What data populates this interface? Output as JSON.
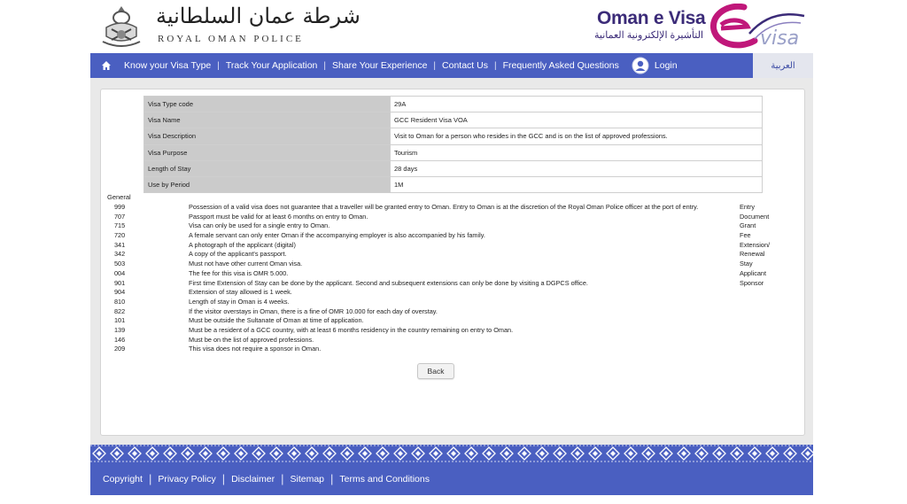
{
  "header": {
    "police_name_ar": "شرطة عمان السلطانية",
    "police_name_en": "ROYAL OMAN POLICE",
    "evisa_title": "Oman e Visa",
    "evisa_subtitle_ar": "التأشيرة الإلكترونية العمانية"
  },
  "nav": {
    "items": [
      "Know your Visa Type",
      "Track Your Application",
      "Share Your Experience",
      "Contact Us",
      "Frequently Asked Questions"
    ],
    "separator": "|",
    "login": "Login",
    "arabic": "العربية"
  },
  "visa_info": [
    {
      "label": "Visa Type code",
      "value": "29A"
    },
    {
      "label": "Visa Name",
      "value": "GCC Resident Visa VOA"
    },
    {
      "label": "Visa Description",
      "value": "Visit to Oman for a person who resides in the GCC and is on the list of approved professions."
    },
    {
      "label": "Visa Purpose",
      "value": "Tourism"
    },
    {
      "label": "Length of Stay",
      "value": "28 days"
    },
    {
      "label": "Use by Period",
      "value": "1M"
    }
  ],
  "general": {
    "label": "General",
    "rules": [
      {
        "code": "999",
        "text": "Possession of a valid visa does not guarantee that a traveller will be granted entry to Oman. Entry to Oman is at the discretion of the Royal Oman Police officer at the port of entry."
      },
      {
        "code": "707",
        "text": "Passport must be valid for at least 6 months on entry to Oman."
      },
      {
        "code": "715",
        "text": "Visa can only be used for a single entry to Oman."
      },
      {
        "code": "720",
        "text": "A female servant can only enter Oman if the accompanying employer is also accompanied by his family."
      },
      {
        "code": "341",
        "text": "A photograph of the applicant (digital)"
      },
      {
        "code": "342",
        "text": "A copy of the applicant's passport."
      },
      {
        "code": "503",
        "text": "Must not have other current Oman visa."
      },
      {
        "code": "004",
        "text": "The fee for this visa is OMR 5.000."
      },
      {
        "code": "901",
        "text": "First time Extension of Stay can be done by the applicant. Second and subsequent extensions can only be done by visiting a DGPCS office."
      },
      {
        "code": "904",
        "text": "Extension of stay allowed is 1 week."
      },
      {
        "code": "810",
        "text": "Length of stay in Oman is 4 weeks."
      },
      {
        "code": "822",
        "text": "If the visitor overstays in Oman, there is a fine of OMR 10.000 for each day of overstay."
      },
      {
        "code": "101",
        "text": "Must be outside the Sultanate of Oman at time of application."
      },
      {
        "code": "139",
        "text": "Must be a resident of a GCC country, with at least 6 months residency in the country remaining on entry to Oman."
      },
      {
        "code": "146",
        "text": "Must be on the list of approved professions."
      },
      {
        "code": "209",
        "text": "This visa does not require a sponsor in Oman."
      }
    ],
    "side_labels": [
      "Entry",
      "Document",
      "Grant",
      "Fee",
      "Extension/",
      "Renewal",
      "Stay",
      "Applicant",
      "Sponsor"
    ]
  },
  "back_button": "Back",
  "footer": {
    "links": [
      "Copyright",
      "Privacy Policy",
      "Disclaimer",
      "Sitemap",
      "Terms and Conditions"
    ],
    "separator": "|"
  },
  "colors": {
    "nav_blue": "#4a5fc1",
    "brand_purple": "#3b2b78",
    "table_label_bg": "#cbcbcb"
  }
}
